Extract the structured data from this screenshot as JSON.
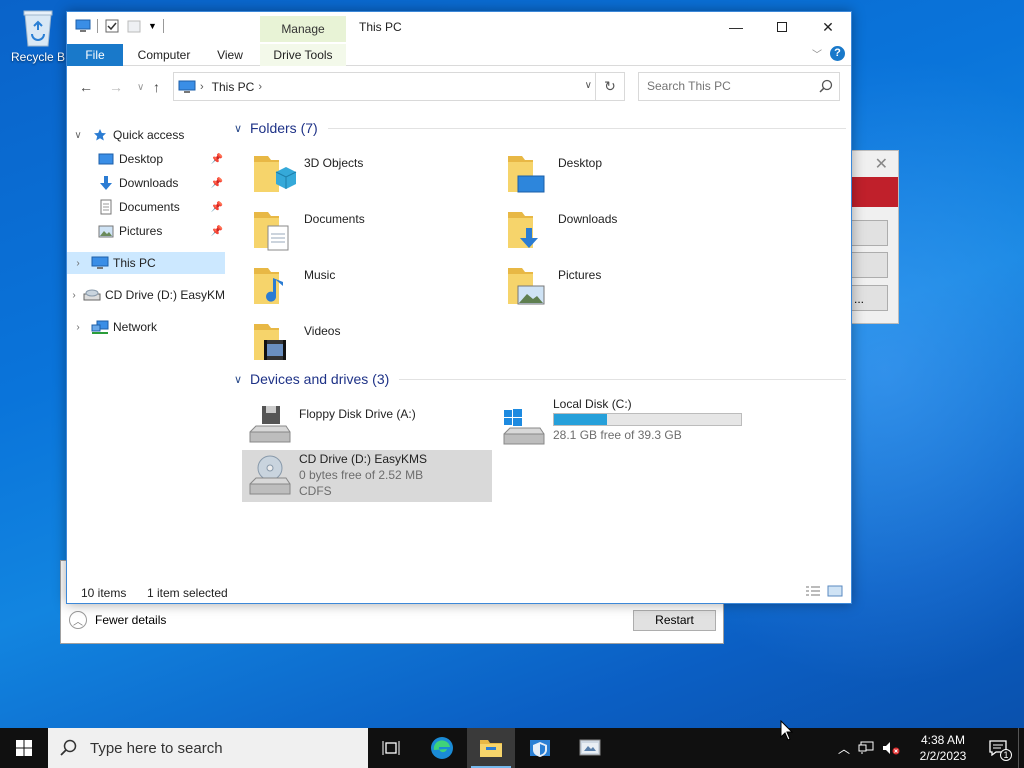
{
  "desktop": {
    "recycle_label": "Recycle B"
  },
  "explorer": {
    "title": "This PC",
    "contextual_tab_group": "Manage",
    "ribbon_tabs": [
      "File",
      "Computer",
      "View",
      "Drive Tools"
    ],
    "address": {
      "crumb": "This PC"
    },
    "search_placeholder": "Search This PC",
    "nav": {
      "quick_access": "Quick access",
      "desktop": "Desktop",
      "downloads": "Downloads",
      "documents": "Documents",
      "pictures": "Pictures",
      "this_pc": "This PC",
      "cd_drive": "CD Drive (D:) EasyKM",
      "network": "Network"
    },
    "folders_header": "Folders (7)",
    "folders": [
      "3D Objects",
      "Desktop",
      "Documents",
      "Downloads",
      "Music",
      "Pictures",
      "Videos"
    ],
    "devices_header": "Devices and drives (3)",
    "devices": {
      "floppy": {
        "name": "Floppy Disk Drive (A:)"
      },
      "local_disk": {
        "name": "Local Disk (C:)",
        "free": "28.1 GB free of 39.3 GB",
        "used_fraction": 0.285
      },
      "cd_drive": {
        "name": "CD Drive (D:) EasyKMS",
        "free": "0 bytes free of 2.52 MB",
        "fs": "CDFS"
      }
    },
    "status": {
      "items": "10 items",
      "selected": "1 item selected"
    }
  },
  "behind_window": {
    "fewer_details": "Fewer details",
    "restart": "Restart"
  },
  "bg_dialog": {
    "button3_label": "..."
  },
  "taskbar": {
    "search_placeholder": "Type here to search",
    "time": "4:38 AM",
    "date": "2/2/2023",
    "notification_count": "1"
  }
}
